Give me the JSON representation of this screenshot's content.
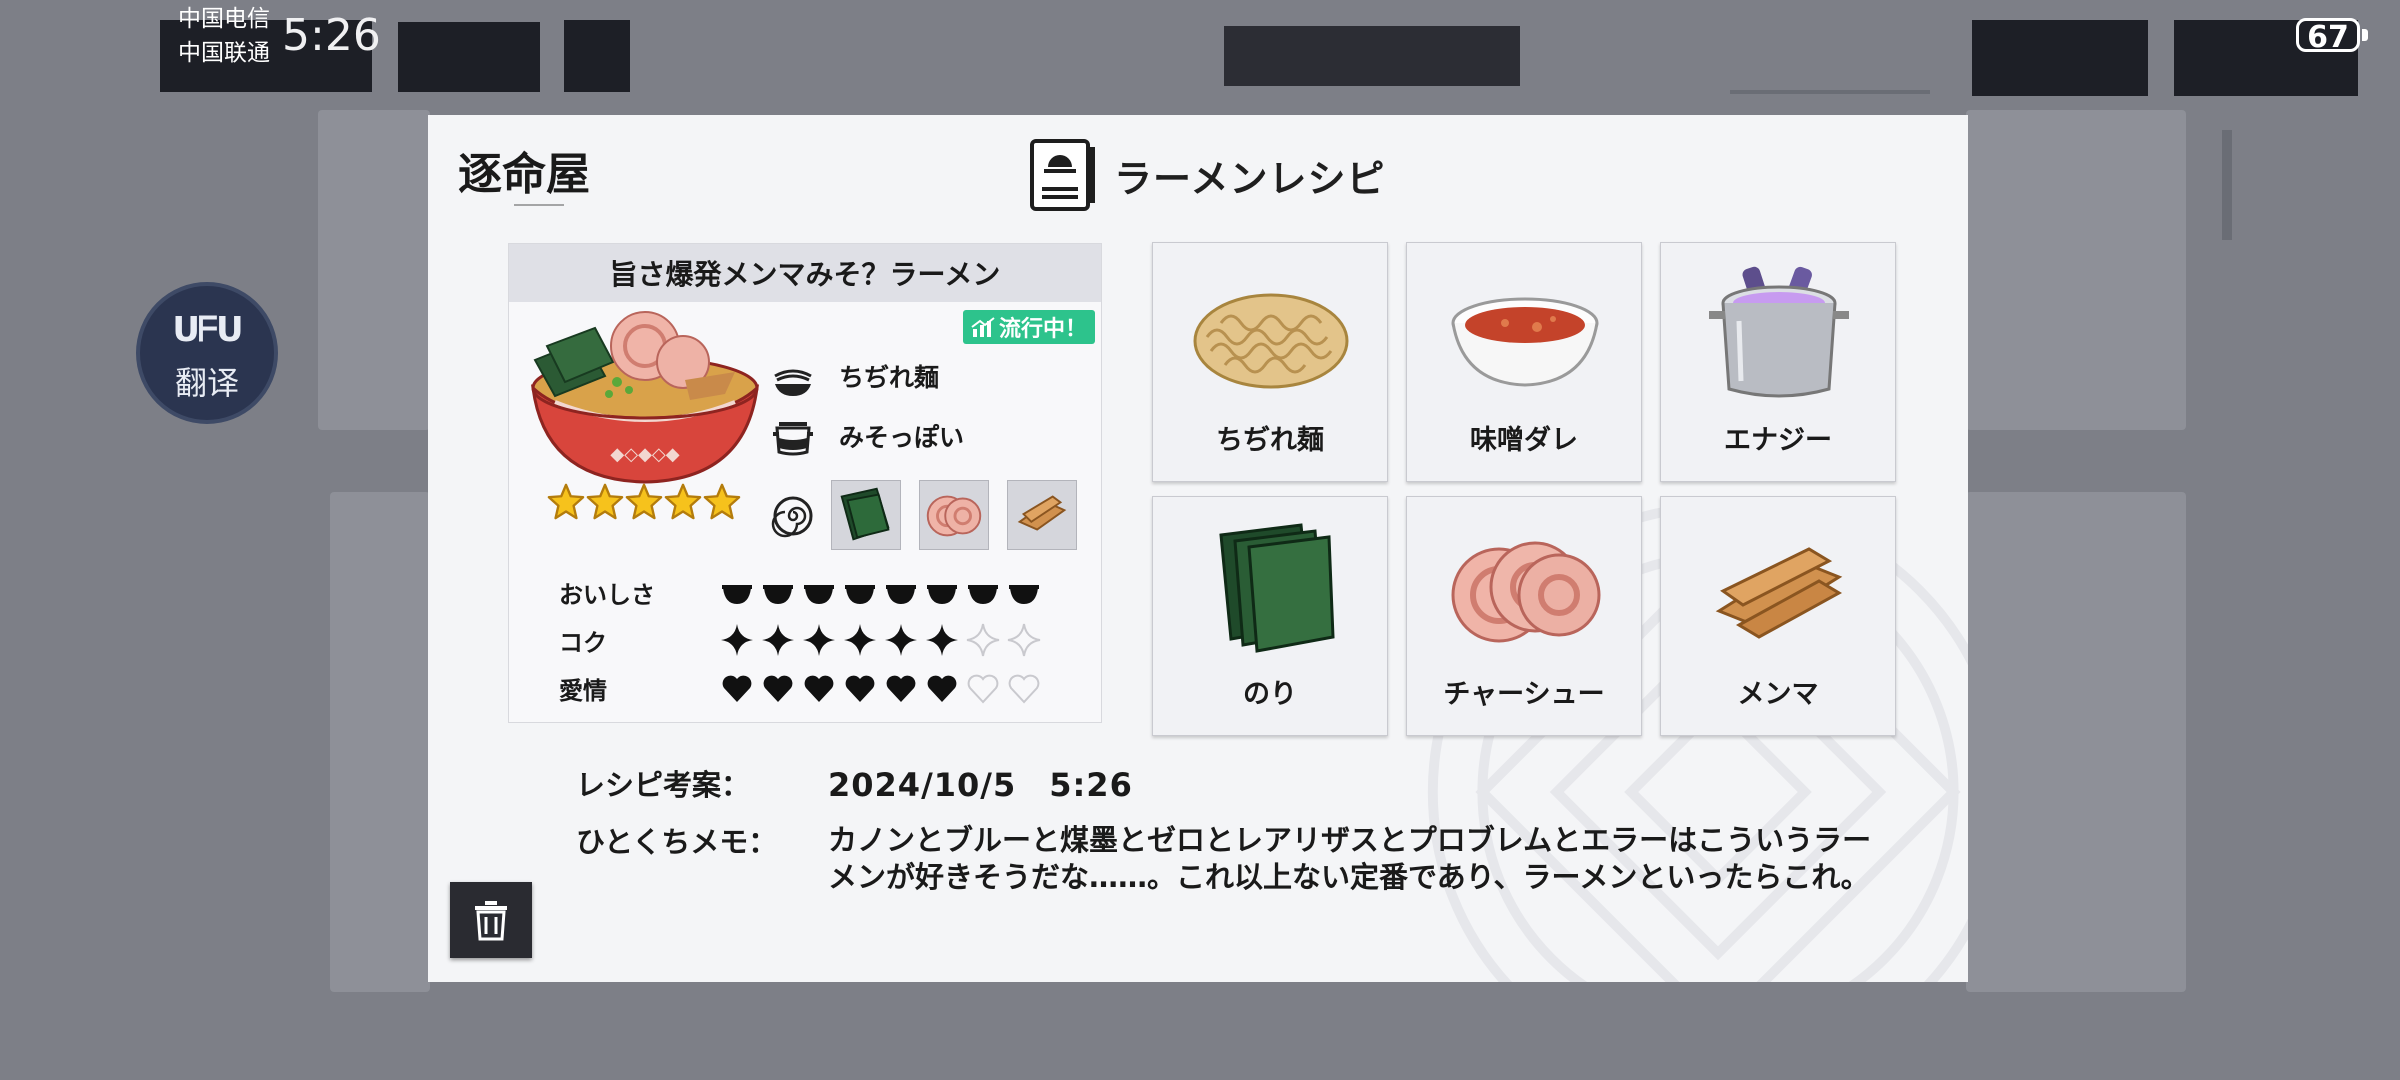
{
  "status_bar": {
    "carrier_1": "中国电信",
    "carrier_2": "中国联通",
    "time": "5:26",
    "battery": "67"
  },
  "translate_button": {
    "logo": "ᑌᖴᑌ",
    "label": "翻译"
  },
  "modal": {
    "brand_logo": "逐命屋",
    "title": "ラーメンレシピ",
    "recipe": {
      "name": "旨さ爆発メンマみそ？ラーメン",
      "rating_stars": 5,
      "trend_badge": "流行中！",
      "noodle": "ちぢれ麺",
      "soup": "みそっぽい",
      "toppings": [
        "nori",
        "chashu",
        "menma"
      ],
      "stats": [
        {
          "name": "おいしさ",
          "icon": "bowl",
          "value": 8,
          "max": 8
        },
        {
          "name": "コク",
          "icon": "sparkle",
          "value": 6,
          "max": 8
        },
        {
          "name": "愛情",
          "icon": "heart",
          "value": 6,
          "max": 8
        }
      ]
    },
    "ingredients": [
      {
        "label": "ちぢれ麺",
        "icon": "noodles-icon"
      },
      {
        "label": "味噌ダレ",
        "icon": "miso-sauce-icon"
      },
      {
        "label": "エナジー",
        "icon": "energy-pot-icon"
      },
      {
        "label": "のり",
        "icon": "nori-icon"
      },
      {
        "label": "チャーシュー",
        "icon": "chashu-icon"
      },
      {
        "label": "メンマ",
        "icon": "menma-icon"
      }
    ],
    "recipe_date_label": "レシピ考案：",
    "recipe_date": "2024/10/5　5:26",
    "memo_label": "ひとくちメモ：",
    "memo": "カノンとブルーと煤墨とゼロとレアリザスとプロブレムとエラーはこういうラーメンが好きそうだな……。これ以上ない定番であり、ラーメンといったらこれ。"
  }
}
